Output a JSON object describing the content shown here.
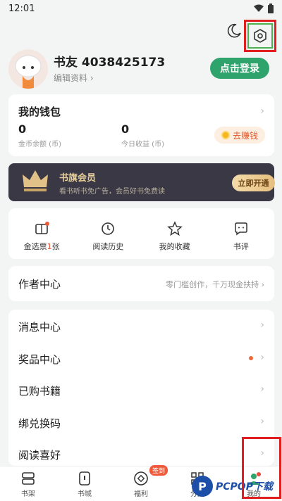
{
  "statusbar": {
    "time": "12:01"
  },
  "profile": {
    "username": "书友 4038425173",
    "edit_label": "编辑资料",
    "login_label": "点击登录"
  },
  "wallet": {
    "title": "我的钱包",
    "coin_balance": "0",
    "coin_label": "金币余额 (币)",
    "today_income": "0",
    "today_label": "今日收益 (币)",
    "earn_label": "去赚钱"
  },
  "vip": {
    "title": "书旗会员",
    "desc": "看书听书免广告，会员好书免费读",
    "open_label": "立即开通"
  },
  "shortcuts": [
    {
      "label_pre": "金选票",
      "count": "1",
      "label_post": "张",
      "icon": "ticket-icon"
    },
    {
      "label": "阅读历史",
      "icon": "clock-icon"
    },
    {
      "label": "我的收藏",
      "icon": "star-icon"
    },
    {
      "label": "书评",
      "icon": "comment-icon"
    }
  ],
  "author": {
    "title": "作者中心",
    "subtitle": "零门槛创作，千万现金扶持"
  },
  "menu": [
    {
      "label": "消息中心"
    },
    {
      "label": "奖品中心"
    },
    {
      "label": "已购书籍"
    },
    {
      "label": "绑兑换码"
    },
    {
      "label": "阅读喜好"
    }
  ],
  "tabbar": [
    {
      "label": "书架",
      "icon": "shelf-icon"
    },
    {
      "label": "书城",
      "icon": "store-icon"
    },
    {
      "label": "福利",
      "icon": "welfare-icon",
      "badge": "签到"
    },
    {
      "label": "分类",
      "icon": "grid-icon"
    },
    {
      "label": "我的",
      "icon": "user-icon"
    }
  ],
  "watermark": {
    "text": "PCPOP下载"
  },
  "colors": {
    "accent": "#2ea36b",
    "highlight_box": "#e02020",
    "vip_bg": "#3a3844"
  }
}
